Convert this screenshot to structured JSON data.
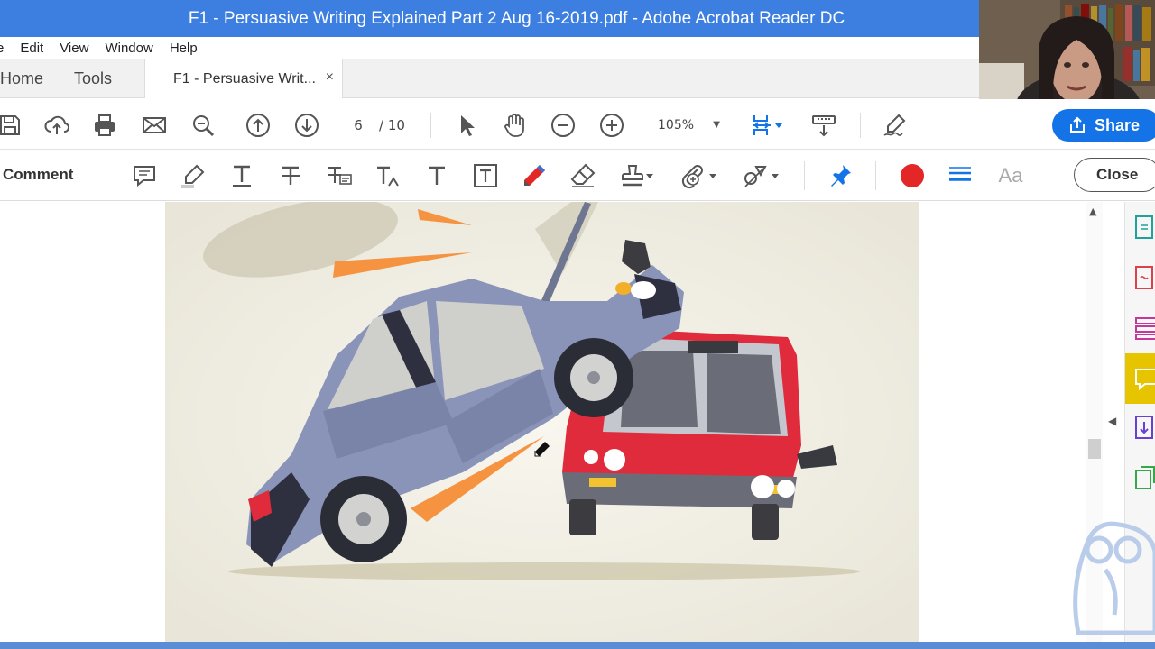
{
  "window": {
    "title": "F1 - Persuasive Writing Explained Part 2 Aug 16-2019.pdf - Adobe Acrobat Reader DC"
  },
  "menu": {
    "items": [
      "e",
      "Edit",
      "View",
      "Window",
      "Help"
    ]
  },
  "nav_tabs": {
    "home": "Home",
    "tools": "Tools",
    "document_tab": "F1 - Persuasive Writ...",
    "close_glyph": "×"
  },
  "toolbar": {
    "current_page": "6",
    "page_separator": "/ 10",
    "zoom": "105%",
    "share_label": "Share"
  },
  "comment_toolbar": {
    "title": "Comment",
    "font_label": "Aa",
    "close_label": "Close"
  },
  "colors": {
    "titlebar": "#3d7fe0",
    "share_button": "#1473e6",
    "active_panel": "#e6c400",
    "color_swatch": "#e32626",
    "page_background": "#efece1",
    "blue_car": "#8a94b8",
    "red_car": "#e02b3c"
  },
  "icons": {
    "toolbar": [
      "save-icon",
      "upload-icon",
      "print-icon",
      "email-icon",
      "zoom-search-icon",
      "page-up-icon",
      "page-down-icon",
      "select-arrow-icon",
      "hand-icon",
      "zoom-out-icon",
      "zoom-in-icon",
      "fit-page-icon",
      "scroll-mode-icon",
      "sign-icon",
      "share-icon"
    ],
    "comment": [
      "sticky-note-icon",
      "highlight-icon",
      "underline-icon",
      "strikethrough-icon",
      "replace-text-icon",
      "insert-text-icon",
      "add-text-icon",
      "text-box-icon",
      "draw-pencil-icon",
      "eraser-icon",
      "stamp-icon",
      "attach-icon",
      "shapes-icon",
      "pin-icon",
      "color-swatch-icon",
      "line-weight-icon"
    ],
    "rail": [
      "export-pdf-icon",
      "create-pdf-icon",
      "organize-pages-icon",
      "comment-panel-icon",
      "compress-icon",
      "edit-pdf-icon"
    ]
  },
  "document_image": {
    "subject": "car-crash-illustration"
  }
}
